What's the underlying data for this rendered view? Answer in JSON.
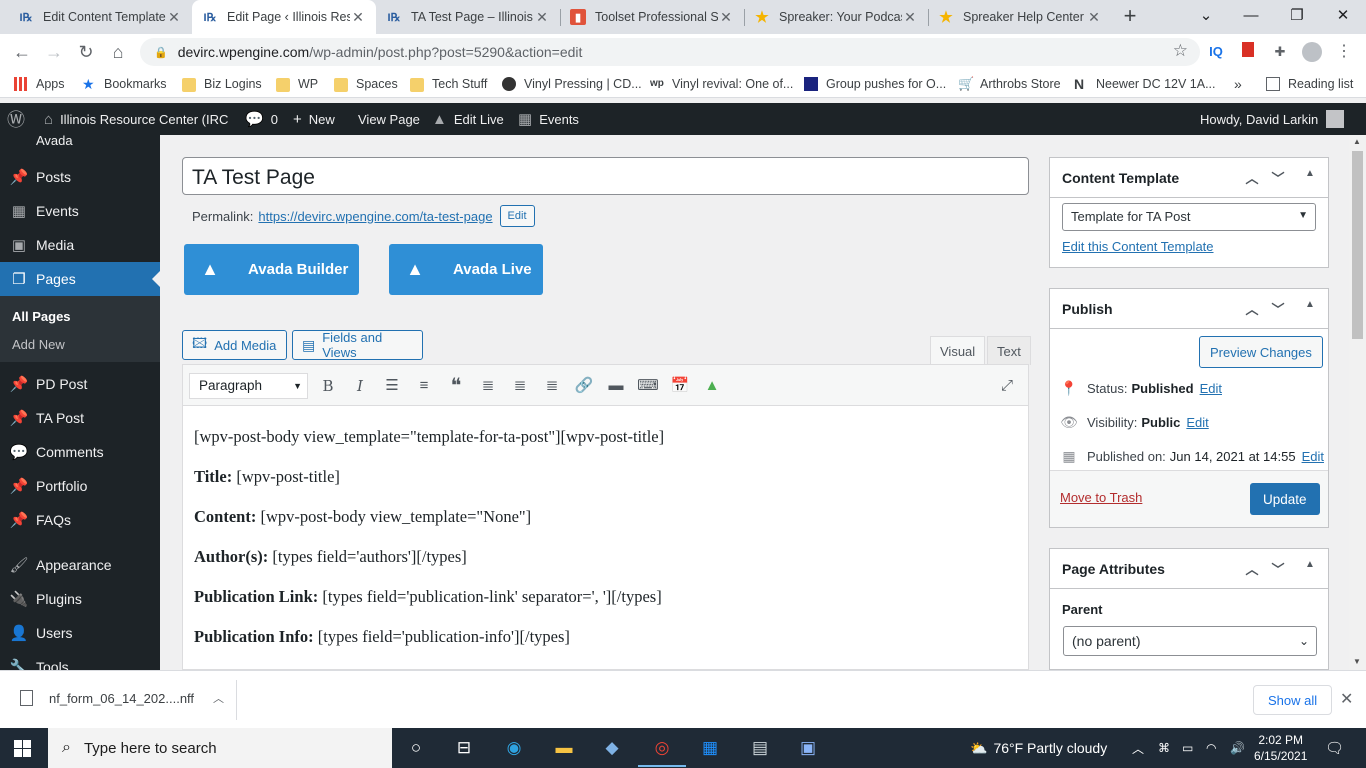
{
  "browser": {
    "tabs": [
      {
        "title": "Edit Content Template",
        "favicon": "IRC"
      },
      {
        "title": "Edit Page ‹ Illinois Reso",
        "favicon": "IRC"
      },
      {
        "title": "TA Test Page – Illinois R",
        "favicon": "IRC"
      },
      {
        "title": "Toolset Professional Su",
        "favicon": "toolset"
      },
      {
        "title": "Spreaker: Your Podcast",
        "favicon": "spreaker"
      },
      {
        "title": "Spreaker Help Center",
        "favicon": "spreaker"
      }
    ],
    "url_host": "devirc.wpengine.com",
    "url_path": "/wp-admin/post.php?post=5290&action=edit",
    "bookmarks": [
      "Apps",
      "Bookmarks",
      "Biz Logins",
      "WP",
      "Spaces",
      "Tech Stuff",
      "Vinyl Pressing | CD...",
      "Vinyl revival: One of...",
      "Group pushes for O...",
      "Arthrobs Store",
      "Neewer DC 12V 1A...",
      "Reading list"
    ]
  },
  "adminbar": {
    "site": "Illinois Resource Center (IRC",
    "comments": "0",
    "new": "New",
    "view_page": "View Page",
    "edit_live": "Edit Live",
    "events": "Events",
    "howdy": "Howdy, David Larkin"
  },
  "sidebar": {
    "top_partial": "Avada",
    "items": [
      "Posts",
      "Events",
      "Media",
      "Pages",
      "PD Post",
      "TA Post",
      "Comments",
      "Portfolio",
      "FAQs",
      "Appearance",
      "Plugins",
      "Users",
      "Tools"
    ],
    "submenu": [
      "All Pages",
      "Add New"
    ]
  },
  "editor": {
    "title": "TA Test Page",
    "permalink_label": "Permalink:",
    "permalink_url": "https://devirc.wpengine.com/ta-test-page",
    "permalink_edit": "Edit",
    "avada_builder": "Avada Builder",
    "avada_live": "Avada Live",
    "add_media": "Add Media",
    "fields_views": "Fields and Views",
    "tab_visual": "Visual",
    "tab_text": "Text",
    "format": "Paragraph",
    "lines": [
      {
        "bold": "",
        "text": "[wpv-post-body view_template=\"template-for-ta-post\"][wpv-post-title]"
      },
      {
        "bold": "Title:",
        "text": " [wpv-post-title]"
      },
      {
        "bold": "Content:",
        "text": " [wpv-post-body view_template=\"None\"]"
      },
      {
        "bold": "Author(s):",
        "text": " [types field='authors'][/types]"
      },
      {
        "bold": "Publication Link:",
        "text": " [types field='publication-link' separator=', '][/types]"
      },
      {
        "bold": "Publication Info:",
        "text": " [types field='publication-info'][/types]"
      }
    ]
  },
  "content_template": {
    "title": "Content Template",
    "selected": "Template for TA Post",
    "edit_link": "Edit this Content Template"
  },
  "publish": {
    "title": "Publish",
    "preview": "Preview Changes",
    "status_label": "Status:",
    "status_value": "Published",
    "visibility_label": "Visibility:",
    "visibility_value": "Public",
    "published_label": "Published on:",
    "published_value": "Jun 14, 2021 at 14:55",
    "edit": "Edit",
    "trash": "Move to Trash",
    "update": "Update"
  },
  "page_attributes": {
    "title": "Page Attributes",
    "parent_label": "Parent",
    "parent_value": "(no parent)"
  },
  "downloads": {
    "file": "nf_form_06_14_202....nff",
    "show_all": "Show all"
  },
  "taskbar": {
    "search_placeholder": "Type here to search",
    "weather": "76°F  Partly cloudy",
    "time": "2:02 PM",
    "date": "6/15/2021"
  },
  "colors": {
    "wp_dark": "#1d2327",
    "wp_blue": "#2271b1",
    "avada_blue": "#2f8fd6",
    "trash_red": "#b32d2e"
  }
}
